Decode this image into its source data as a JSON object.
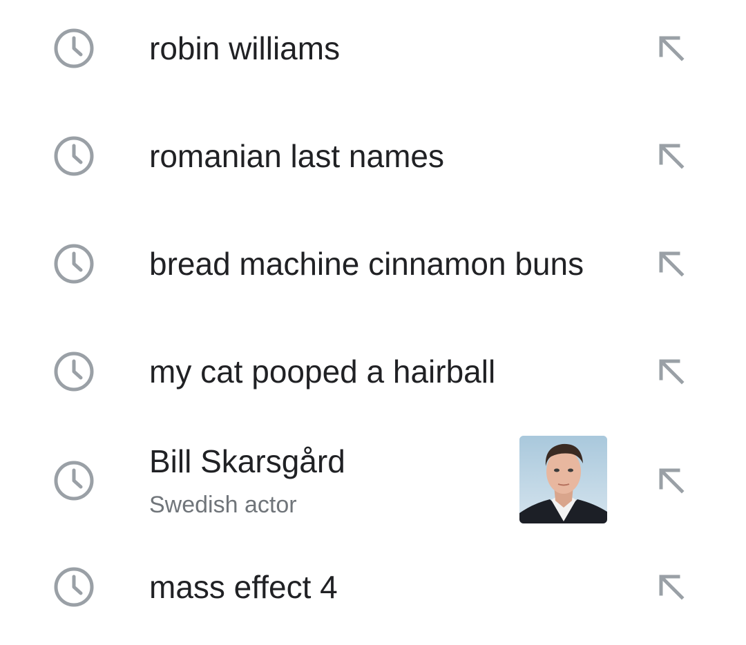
{
  "suggestions": [
    {
      "icon": "clock-history-icon",
      "text": "robin williams",
      "action_icon": "insert-arrow-icon"
    },
    {
      "icon": "clock-history-icon",
      "text": "romanian last names",
      "action_icon": "insert-arrow-icon"
    },
    {
      "icon": "clock-history-icon",
      "text": "bread machine cinnamon buns",
      "action_icon": "insert-arrow-icon"
    },
    {
      "icon": "clock-history-icon",
      "text": "my cat pooped a hairball",
      "action_icon": "insert-arrow-icon"
    },
    {
      "icon": "clock-history-icon",
      "text": "Bill Skarsgård",
      "subtitle": "Swedish actor",
      "thumbnail": "person-photo",
      "action_icon": "insert-arrow-icon"
    },
    {
      "icon": "clock-history-icon",
      "text": "mass effect 4",
      "action_icon": "insert-arrow-icon"
    }
  ],
  "colors": {
    "icon_gray": "#9aa0a6",
    "text_primary": "#202124",
    "text_secondary": "#70757a",
    "background": "#ffffff"
  }
}
